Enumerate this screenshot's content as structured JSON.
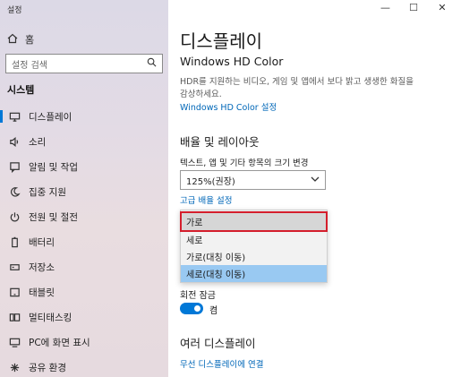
{
  "window": {
    "title": "설정",
    "controls": [
      "—",
      "☐",
      "✕"
    ]
  },
  "sidebar": {
    "home_label": "홈",
    "search_placeholder": "설정 검색",
    "section": "시스템",
    "items": [
      {
        "label": "디스플레이",
        "icon": "monitor-icon",
        "active": true
      },
      {
        "label": "소리",
        "icon": "speaker-icon"
      },
      {
        "label": "알림 및 작업",
        "icon": "notification-icon"
      },
      {
        "label": "집중 지원",
        "icon": "moon-icon"
      },
      {
        "label": "전원 및 절전",
        "icon": "power-icon"
      },
      {
        "label": "배터리",
        "icon": "battery-icon"
      },
      {
        "label": "저장소",
        "icon": "storage-icon"
      },
      {
        "label": "태블릿",
        "icon": "tablet-icon"
      },
      {
        "label": "멀티태스킹",
        "icon": "multitasking-icon"
      },
      {
        "label": "PC에 화면 표시",
        "icon": "project-icon"
      },
      {
        "label": "공유 환경",
        "icon": "shared-experience-icon"
      }
    ]
  },
  "main": {
    "title": "디스플레이",
    "hd_color": {
      "heading": "Windows HD Color",
      "description": "HDR를 지원하는 비디오, 게임 및 앱에서 보다 밝고 생생한 화질을 감상하세요.",
      "link": "Windows HD Color 설정"
    },
    "scale_layout": {
      "heading": "배율 및 레이아웃",
      "scale_label": "텍스트, 앱 및 기타 항목의 크기 변경",
      "scale_value": "125%(권장)",
      "advanced_link": "고급 배율 설정"
    },
    "orientation_options": [
      {
        "label": "가로",
        "state": "hover"
      },
      {
        "label": "세로",
        "state": ""
      },
      {
        "label": "가로(대칭 이동)",
        "state": ""
      },
      {
        "label": "세로(대칭 이동)",
        "state": "selected"
      }
    ],
    "rotation_lock": {
      "label": "회전 잠금",
      "value": "켬",
      "on": true
    },
    "multi_display": {
      "heading": "여러 디스플레이",
      "link": "무선 디스플레이에 연결"
    }
  },
  "colors": {
    "accent": "#0078d7",
    "link": "#0067b8",
    "selected_option": "#99c9f2",
    "focus_outline": "#d41e2c"
  }
}
